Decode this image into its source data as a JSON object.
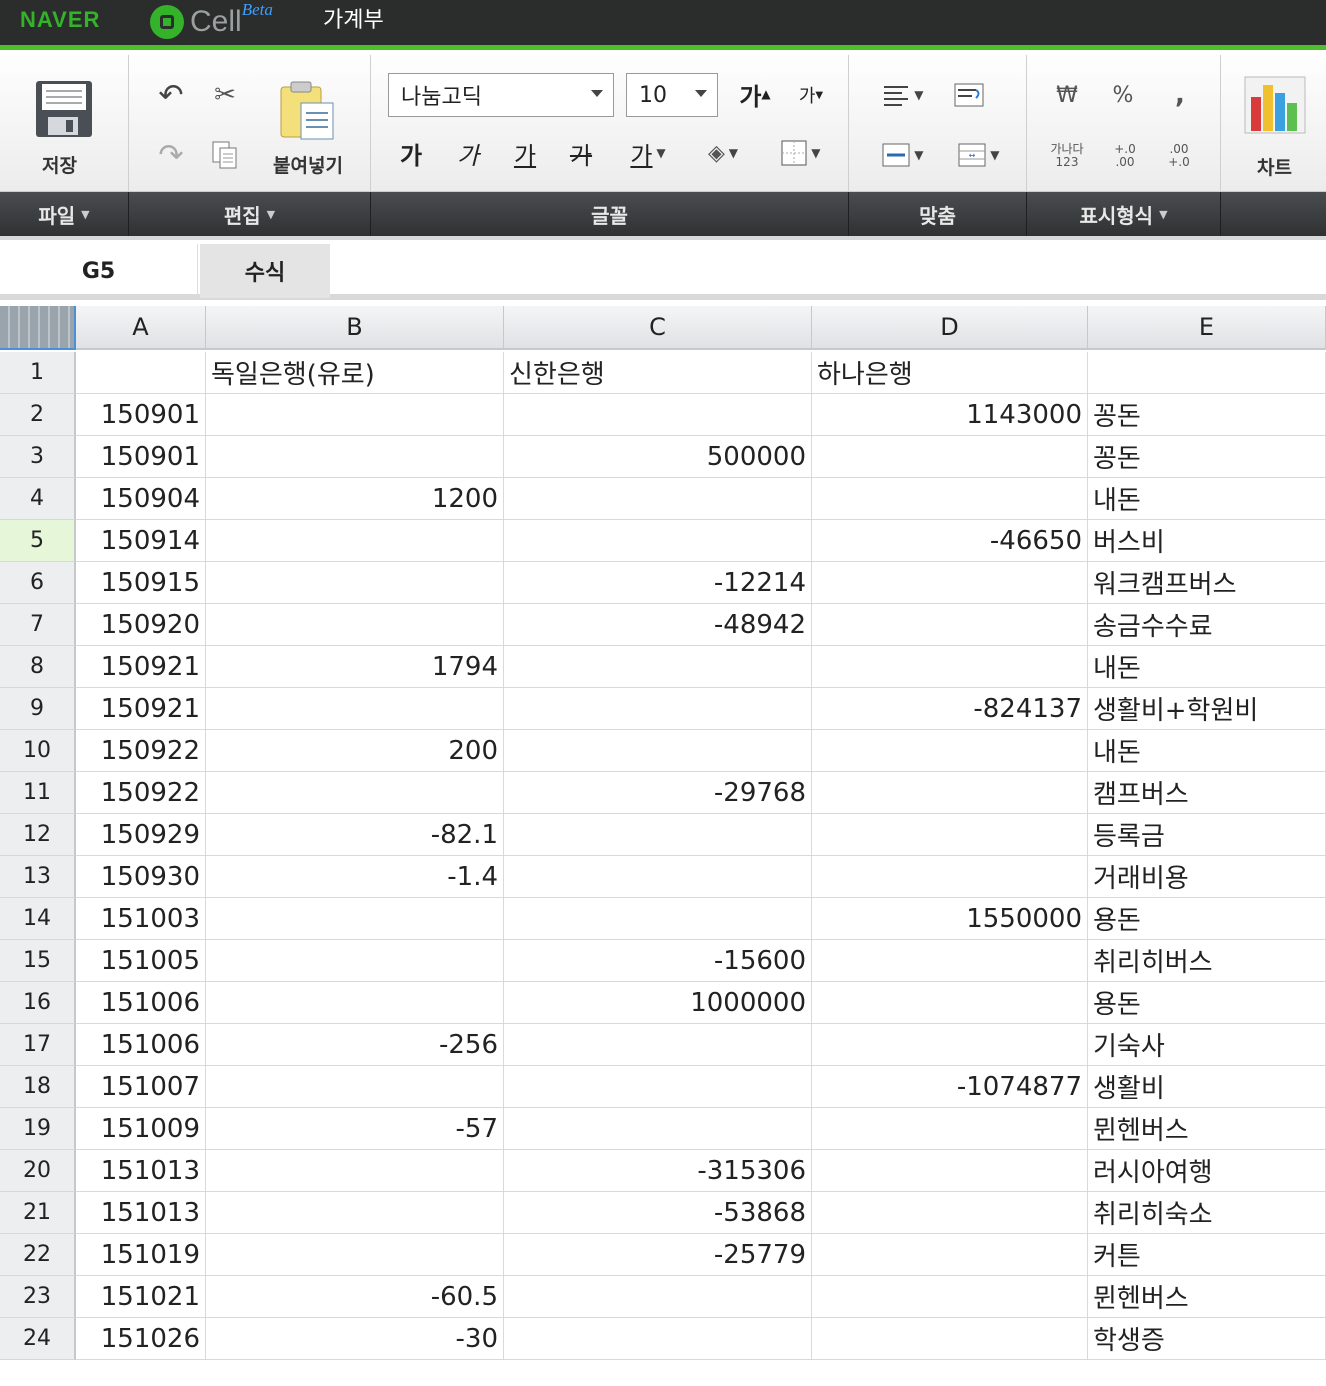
{
  "topbar": {
    "naver": "NAVER",
    "cell": "Cell",
    "beta": "Beta",
    "doc_title": "가계부"
  },
  "ribbon": {
    "save_label": "저장",
    "paste_label": "붙여넣기",
    "font_name": "나눔고딕",
    "font_size": "10",
    "grow_font": "가",
    "shrink_font": "가",
    "bold": "가",
    "italic": "가",
    "underline": "가",
    "strike": "가",
    "font_color": "가",
    "currency": "₩",
    "percent": "%",
    "comma": ",",
    "number_format": "가나다 123",
    "inc_decimal": "+.0 .00",
    "dec_decimal": ".00 +.0",
    "chart_label": "차트",
    "groups": [
      "파일",
      "편집",
      "글꼴",
      "맞춤",
      "표시형식"
    ]
  },
  "formula_bar": {
    "cell_ref": "G5",
    "label": "수식"
  },
  "columns": [
    "A",
    "B",
    "C",
    "D",
    "E"
  ],
  "rows": [
    {
      "n": "1",
      "a": "",
      "b": "독일은행(유로)",
      "c": "신한은행",
      "d": "하나은행",
      "e": ""
    },
    {
      "n": "2",
      "a": "150901",
      "b": "",
      "c": "",
      "d": "1143000",
      "e": "꽁돈"
    },
    {
      "n": "3",
      "a": "150901",
      "b": "",
      "c": "500000",
      "d": "",
      "e": "꽁돈"
    },
    {
      "n": "4",
      "a": "150904",
      "b": "1200",
      "c": "",
      "d": "",
      "e": "내돈"
    },
    {
      "n": "5",
      "a": "150914",
      "b": "",
      "c": "",
      "d": "-46650",
      "e": "버스비"
    },
    {
      "n": "6",
      "a": "150915",
      "b": "",
      "c": "-12214",
      "d": "",
      "e": "워크캠프버스"
    },
    {
      "n": "7",
      "a": "150920",
      "b": "",
      "c": "-48942",
      "d": "",
      "e": "송금수수료"
    },
    {
      "n": "8",
      "a": "150921",
      "b": "1794",
      "c": "",
      "d": "",
      "e": "내돈"
    },
    {
      "n": "9",
      "a": "150921",
      "b": "",
      "c": "",
      "d": "-824137",
      "e": "생활비+학원비"
    },
    {
      "n": "10",
      "a": "150922",
      "b": "200",
      "c": "",
      "d": "",
      "e": "내돈"
    },
    {
      "n": "11",
      "a": "150922",
      "b": "",
      "c": "-29768",
      "d": "",
      "e": "캠프버스"
    },
    {
      "n": "12",
      "a": "150929",
      "b": "-82.1",
      "c": "",
      "d": "",
      "e": "등록금"
    },
    {
      "n": "13",
      "a": "150930",
      "b": "-1.4",
      "c": "",
      "d": "",
      "e": "거래비용"
    },
    {
      "n": "14",
      "a": "151003",
      "b": "",
      "c": "",
      "d": "1550000",
      "e": "용돈"
    },
    {
      "n": "15",
      "a": "151005",
      "b": "",
      "c": "-15600",
      "d": "",
      "e": "취리히버스"
    },
    {
      "n": "16",
      "a": "151006",
      "b": "",
      "c": "1000000",
      "d": "",
      "e": "용돈"
    },
    {
      "n": "17",
      "a": "151006",
      "b": "-256",
      "c": "",
      "d": "",
      "e": "기숙사"
    },
    {
      "n": "18",
      "a": "151007",
      "b": "",
      "c": "",
      "d": "-1074877",
      "e": "생활비"
    },
    {
      "n": "19",
      "a": "151009",
      "b": "-57",
      "c": "",
      "d": "",
      "e": "뮌헨버스"
    },
    {
      "n": "20",
      "a": "151013",
      "b": "",
      "c": "-315306",
      "d": "",
      "e": "러시아여행"
    },
    {
      "n": "21",
      "a": "151013",
      "b": "",
      "c": "-53868",
      "d": "",
      "e": "취리히숙소"
    },
    {
      "n": "22",
      "a": "151019",
      "b": "",
      "c": "-25779",
      "d": "",
      "e": "커튼"
    },
    {
      "n": "23",
      "a": "151021",
      "b": "-60.5",
      "c": "",
      "d": "",
      "e": "뮌헨버스"
    },
    {
      "n": "24",
      "a": "151026",
      "b": "-30",
      "c": "",
      "d": "",
      "e": "학생증"
    }
  ],
  "active_row": "5"
}
